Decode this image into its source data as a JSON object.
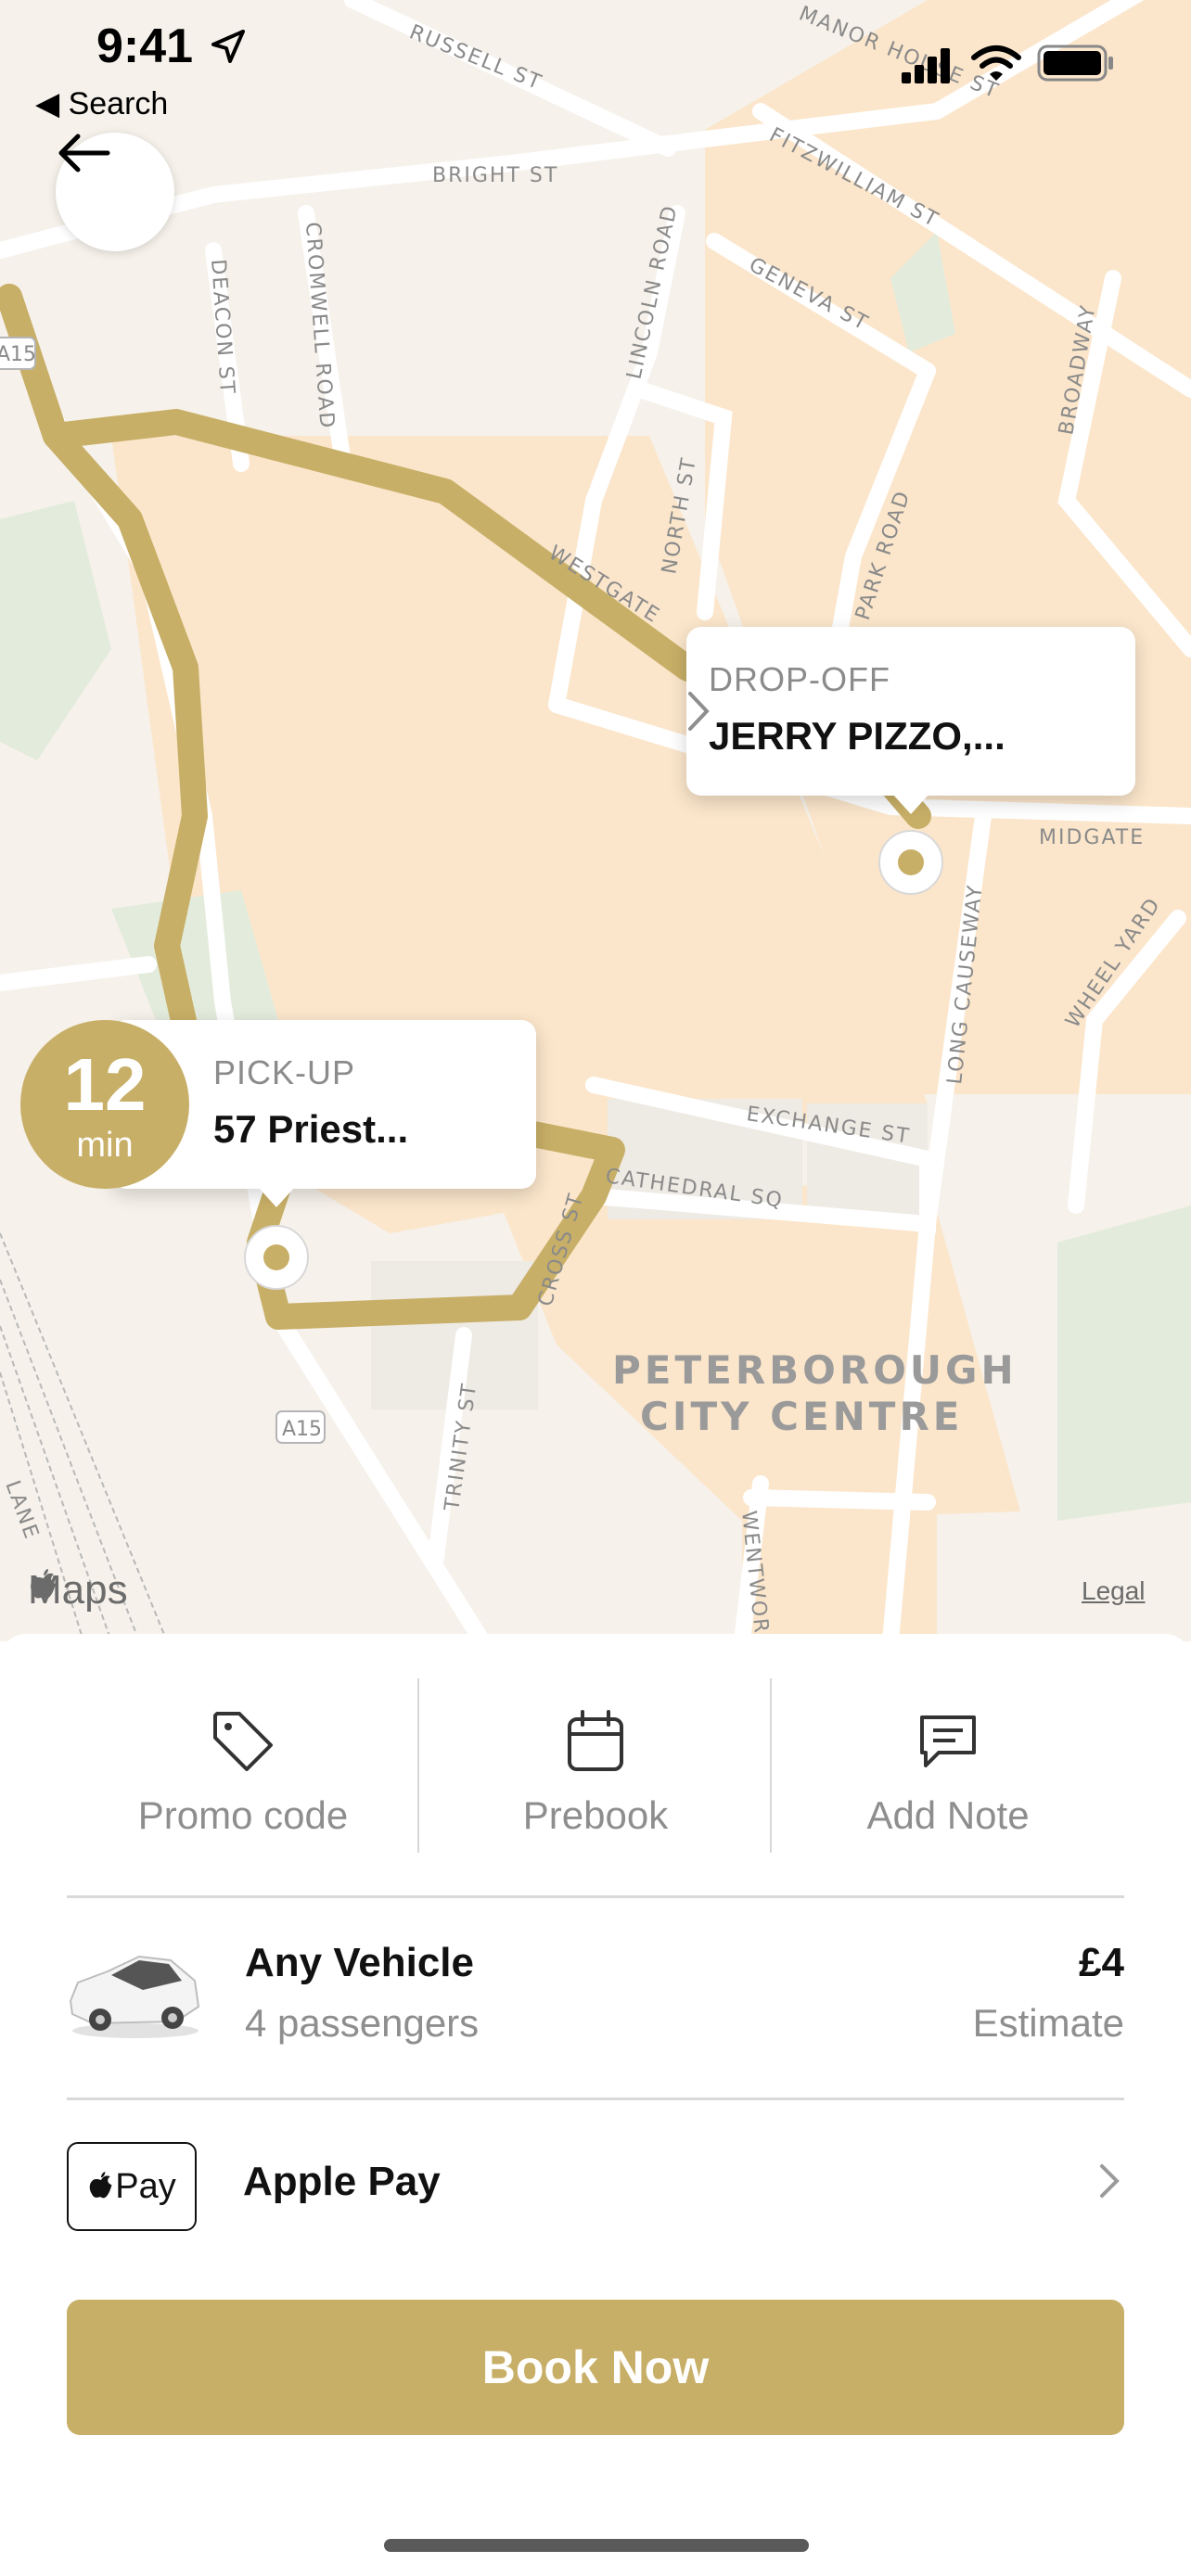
{
  "status_bar": {
    "time": "9:41",
    "back_app": "Search"
  },
  "colors": {
    "accent": "#c8af67",
    "route": "#c8af67",
    "map_bg": "#f6f1ea",
    "block": "#fbe6cb"
  },
  "map": {
    "district": [
      "PETERBOROUGH",
      "CITY CENTRE"
    ],
    "streets": [
      "RUSSELL ST",
      "MANOR HOUSE ST",
      "BRIGHT ST",
      "FITZWILLIAM ST",
      "GENEVA ST",
      "CROMWELL ROAD",
      "DEACON ST",
      "LINCOLN ROAD",
      "NORTH ST",
      "PARK ROAD",
      "BROADWAY",
      "WESTGATE",
      "MIDGATE",
      "LONG CAUSEWAY",
      "WHEEL YARD",
      "EXCHANGE ST",
      "CATHEDRAL SQ",
      "CROSS ST",
      "TRINITY ST",
      "WENTWOR",
      "A15",
      "A15",
      "LANE"
    ],
    "attribution": "Maps",
    "legal": "Legal"
  },
  "dropoff": {
    "label": "DROP-OFF",
    "value": "JERRY PIZZO,..."
  },
  "pickup": {
    "label": "PICK-UP",
    "value": "57 Priest...",
    "eta_value": "12",
    "eta_unit": "min"
  },
  "actions": [
    {
      "label": "Promo code",
      "icon": "tag-icon"
    },
    {
      "label": "Prebook",
      "icon": "calendar-icon"
    },
    {
      "label": "Add Note",
      "icon": "message-icon"
    }
  ],
  "vehicle": {
    "name": "Any Vehicle",
    "passengers": "4 passengers",
    "price": "£4",
    "price_note": "Estimate"
  },
  "payment": {
    "badge": "Pay",
    "label": "Apple Pay"
  },
  "book_button": "Book Now"
}
